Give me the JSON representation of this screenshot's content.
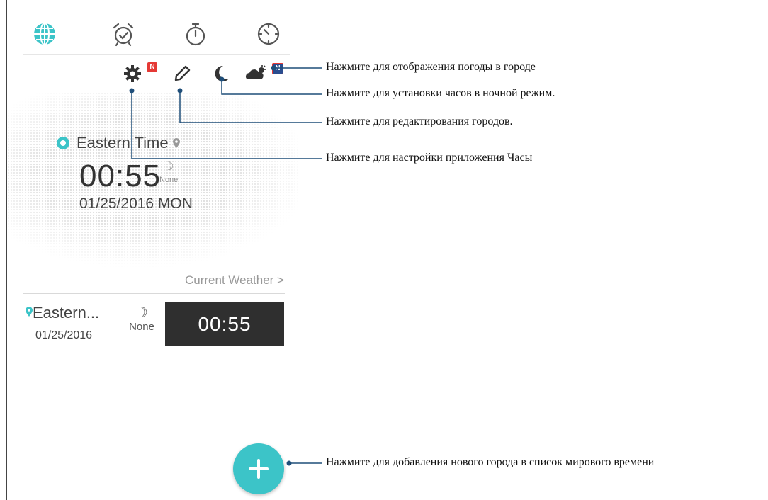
{
  "tabs": [
    {
      "icon": "globe-icon",
      "active": true
    },
    {
      "icon": "alarm-icon",
      "active": false
    },
    {
      "icon": "stopwatch-icon",
      "active": false
    },
    {
      "icon": "timer-icon",
      "active": false
    }
  ],
  "toolbar": {
    "settings_badge": "N",
    "weather_badge": "N",
    "icons": [
      "settings-icon",
      "edit-icon",
      "night-mode-icon",
      "weather-icon"
    ]
  },
  "main_clock": {
    "city": "Eastern Time",
    "time": "00:55",
    "night_label": "None",
    "date": "01/25/2016 MON"
  },
  "current_weather_link": "Current Weather >",
  "city_list": [
    {
      "name": "Eastern...",
      "date": "01/25/2016",
      "night_label": "None",
      "time": "00:55"
    }
  ],
  "callouts": {
    "weather": "Нажмите для отображения погоды в городе",
    "night_mode": "Нажмите для установки часов в ночной режим.",
    "edit": "Нажмите для редактирования городов.",
    "settings": "Нажмите для настройки приложения Часы",
    "add_city": "Нажмите для добавления нового города в список мирового времени"
  },
  "colors": {
    "accent": "#3cc4c8",
    "badge": "#e53935",
    "callout_line": "#1f4e79",
    "clock_bg": "#2f2f2f"
  }
}
